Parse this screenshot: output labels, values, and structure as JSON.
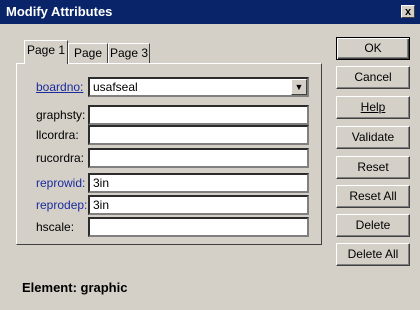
{
  "window": {
    "title": "Modify Attributes",
    "close_glyph": "x"
  },
  "tabs": [
    {
      "label": "Page 1",
      "active": true
    },
    {
      "label": "Page 2",
      "active": false
    },
    {
      "label": "Page 3",
      "active": false
    }
  ],
  "fields": [
    {
      "label": "boardno:",
      "value": "usafseal",
      "kind": "dropdown",
      "label_style": "link"
    },
    {
      "label": "graphsty:",
      "value": "",
      "kind": "text",
      "label_style": "plain"
    },
    {
      "label": "llcordra:",
      "value": "",
      "kind": "text",
      "label_style": "plain"
    },
    {
      "label": "rucordra:",
      "value": "",
      "kind": "text",
      "label_style": "plain"
    },
    {
      "label": "reprowid:",
      "value": "3in",
      "kind": "text",
      "label_style": "blue"
    },
    {
      "label": "reprodep:",
      "value": "3in",
      "kind": "text",
      "label_style": "blue"
    },
    {
      "label": "hscale:",
      "value": "",
      "kind": "text",
      "label_style": "plain"
    }
  ],
  "buttons": {
    "ok": "OK",
    "cancel": "Cancel",
    "help": "Help",
    "validate": "Validate",
    "reset": "Reset",
    "reset_all": "Reset All",
    "delete": "Delete",
    "delete_all": "Delete All"
  },
  "dropdown_icon": "triangle-down",
  "status": {
    "element_text": "Element: graphic"
  },
  "colors": {
    "titlebar": "#0a246a",
    "link": "#1a2a9c",
    "face": "#d4d0c8"
  }
}
